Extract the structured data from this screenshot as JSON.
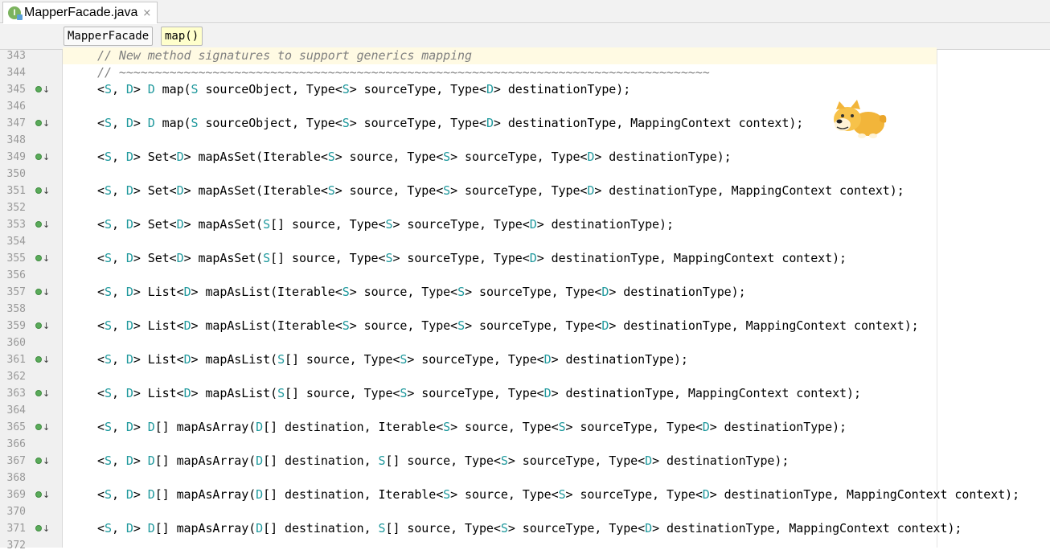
{
  "tab": {
    "title": "MapperFacade.java",
    "icon_letter": "I",
    "close_glyph": "×"
  },
  "breadcrumb": {
    "items": [
      "MapperFacade",
      "map()"
    ]
  },
  "lines": [
    {
      "num": "343",
      "kind": "comment",
      "text": "// New method signatures to support generics mapping",
      "icon": false,
      "highlight": true
    },
    {
      "num": "344",
      "kind": "comment",
      "text": "// ~~~~~~~~~~~~~~~~~~~~~~~~~~~~~~~~~~~~~~~~~~~~~~~~~~~~~~~~~~~~~~~~~~~~~~~~~~~~~~~~~~",
      "icon": false
    },
    {
      "num": "345",
      "kind": "code",
      "icon": true,
      "segs": [
        [
          "<",
          ""
        ],
        [
          "S",
          "tp"
        ],
        [
          ", ",
          ""
        ],
        [
          "D",
          "tp"
        ],
        [
          "> ",
          ""
        ],
        [
          "D",
          "tp"
        ],
        [
          " map(",
          ""
        ],
        [
          "S",
          "tp"
        ],
        [
          " sourceObject, Type<",
          ""
        ],
        [
          "S",
          "tp"
        ],
        [
          "> sourceType, Type<",
          ""
        ],
        [
          "D",
          "tp"
        ],
        [
          "> destinationType);",
          ""
        ]
      ]
    },
    {
      "num": "346",
      "kind": "blank",
      "icon": false
    },
    {
      "num": "347",
      "kind": "code",
      "icon": true,
      "segs": [
        [
          "<",
          ""
        ],
        [
          "S",
          "tp"
        ],
        [
          ", ",
          ""
        ],
        [
          "D",
          "tp"
        ],
        [
          "> ",
          ""
        ],
        [
          "D",
          "tp"
        ],
        [
          " map(",
          ""
        ],
        [
          "S",
          "tp"
        ],
        [
          " sourceObject, Type<",
          ""
        ],
        [
          "S",
          "tp"
        ],
        [
          "> sourceType, Type<",
          ""
        ],
        [
          "D",
          "tp"
        ],
        [
          "> destinationType, MappingContext context);",
          ""
        ]
      ]
    },
    {
      "num": "348",
      "kind": "blank",
      "icon": false
    },
    {
      "num": "349",
      "kind": "code",
      "icon": true,
      "segs": [
        [
          "<",
          ""
        ],
        [
          "S",
          "tp"
        ],
        [
          ", ",
          ""
        ],
        [
          "D",
          "tp"
        ],
        [
          "> Set<",
          ""
        ],
        [
          "D",
          "tp"
        ],
        [
          "> mapAsSet(Iterable<",
          ""
        ],
        [
          "S",
          "tp"
        ],
        [
          "> source, Type<",
          ""
        ],
        [
          "S",
          "tp"
        ],
        [
          "> sourceType, Type<",
          ""
        ],
        [
          "D",
          "tp"
        ],
        [
          "> destinationType);",
          ""
        ]
      ]
    },
    {
      "num": "350",
      "kind": "blank",
      "icon": false
    },
    {
      "num": "351",
      "kind": "code",
      "icon": true,
      "segs": [
        [
          "<",
          ""
        ],
        [
          "S",
          "tp"
        ],
        [
          ", ",
          ""
        ],
        [
          "D",
          "tp"
        ],
        [
          "> Set<",
          ""
        ],
        [
          "D",
          "tp"
        ],
        [
          "> mapAsSet(Iterable<",
          ""
        ],
        [
          "S",
          "tp"
        ],
        [
          "> source, Type<",
          ""
        ],
        [
          "S",
          "tp"
        ],
        [
          "> sourceType, Type<",
          ""
        ],
        [
          "D",
          "tp"
        ],
        [
          "> destinationType, MappingContext context);",
          ""
        ]
      ]
    },
    {
      "num": "352",
      "kind": "blank",
      "icon": false
    },
    {
      "num": "353",
      "kind": "code",
      "icon": true,
      "segs": [
        [
          "<",
          ""
        ],
        [
          "S",
          "tp"
        ],
        [
          ", ",
          ""
        ],
        [
          "D",
          "tp"
        ],
        [
          "> Set<",
          ""
        ],
        [
          "D",
          "tp"
        ],
        [
          "> mapAsSet(",
          ""
        ],
        [
          "S",
          "tp"
        ],
        [
          "[] source, Type<",
          ""
        ],
        [
          "S",
          "tp"
        ],
        [
          "> sourceType, Type<",
          ""
        ],
        [
          "D",
          "tp"
        ],
        [
          "> destinationType);",
          ""
        ]
      ]
    },
    {
      "num": "354",
      "kind": "blank",
      "icon": false
    },
    {
      "num": "355",
      "kind": "code",
      "icon": true,
      "segs": [
        [
          "<",
          ""
        ],
        [
          "S",
          "tp"
        ],
        [
          ", ",
          ""
        ],
        [
          "D",
          "tp"
        ],
        [
          "> Set<",
          ""
        ],
        [
          "D",
          "tp"
        ],
        [
          "> mapAsSet(",
          ""
        ],
        [
          "S",
          "tp"
        ],
        [
          "[] source, Type<",
          ""
        ],
        [
          "S",
          "tp"
        ],
        [
          "> sourceType, Type<",
          ""
        ],
        [
          "D",
          "tp"
        ],
        [
          "> destinationType, MappingContext context);",
          ""
        ]
      ]
    },
    {
      "num": "356",
      "kind": "blank",
      "icon": false
    },
    {
      "num": "357",
      "kind": "code",
      "icon": true,
      "segs": [
        [
          "<",
          ""
        ],
        [
          "S",
          "tp"
        ],
        [
          ", ",
          ""
        ],
        [
          "D",
          "tp"
        ],
        [
          "> List<",
          ""
        ],
        [
          "D",
          "tp"
        ],
        [
          "> mapAsList(Iterable<",
          ""
        ],
        [
          "S",
          "tp"
        ],
        [
          "> source, Type<",
          ""
        ],
        [
          "S",
          "tp"
        ],
        [
          "> sourceType, Type<",
          ""
        ],
        [
          "D",
          "tp"
        ],
        [
          "> destinationType);",
          ""
        ]
      ]
    },
    {
      "num": "358",
      "kind": "blank",
      "icon": false
    },
    {
      "num": "359",
      "kind": "code",
      "icon": true,
      "segs": [
        [
          "<",
          ""
        ],
        [
          "S",
          "tp"
        ],
        [
          ", ",
          ""
        ],
        [
          "D",
          "tp"
        ],
        [
          "> List<",
          ""
        ],
        [
          "D",
          "tp"
        ],
        [
          "> mapAsList(Iterable<",
          ""
        ],
        [
          "S",
          "tp"
        ],
        [
          "> source, Type<",
          ""
        ],
        [
          "S",
          "tp"
        ],
        [
          "> sourceType, Type<",
          ""
        ],
        [
          "D",
          "tp"
        ],
        [
          "> destinationType, MappingContext context);",
          ""
        ]
      ]
    },
    {
      "num": "360",
      "kind": "blank",
      "icon": false
    },
    {
      "num": "361",
      "kind": "code",
      "icon": true,
      "segs": [
        [
          "<",
          ""
        ],
        [
          "S",
          "tp"
        ],
        [
          ", ",
          ""
        ],
        [
          "D",
          "tp"
        ],
        [
          "> List<",
          ""
        ],
        [
          "D",
          "tp"
        ],
        [
          "> mapAsList(",
          ""
        ],
        [
          "S",
          "tp"
        ],
        [
          "[] source, Type<",
          ""
        ],
        [
          "S",
          "tp"
        ],
        [
          "> sourceType, Type<",
          ""
        ],
        [
          "D",
          "tp"
        ],
        [
          "> destinationType);",
          ""
        ]
      ]
    },
    {
      "num": "362",
      "kind": "blank",
      "icon": false
    },
    {
      "num": "363",
      "kind": "code",
      "icon": true,
      "segs": [
        [
          "<",
          ""
        ],
        [
          "S",
          "tp"
        ],
        [
          ", ",
          ""
        ],
        [
          "D",
          "tp"
        ],
        [
          "> List<",
          ""
        ],
        [
          "D",
          "tp"
        ],
        [
          "> mapAsList(",
          ""
        ],
        [
          "S",
          "tp"
        ],
        [
          "[] source, Type<",
          ""
        ],
        [
          "S",
          "tp"
        ],
        [
          "> sourceType, Type<",
          ""
        ],
        [
          "D",
          "tp"
        ],
        [
          "> destinationType, MappingContext context);",
          ""
        ]
      ]
    },
    {
      "num": "364",
      "kind": "blank",
      "icon": false
    },
    {
      "num": "365",
      "kind": "code",
      "icon": true,
      "segs": [
        [
          "<",
          ""
        ],
        [
          "S",
          "tp"
        ],
        [
          ", ",
          ""
        ],
        [
          "D",
          "tp"
        ],
        [
          "> ",
          ""
        ],
        [
          "D",
          "tp"
        ],
        [
          "[] mapAsArray(",
          ""
        ],
        [
          "D",
          "tp"
        ],
        [
          "[] destination, Iterable<",
          ""
        ],
        [
          "S",
          "tp"
        ],
        [
          "> source, Type<",
          ""
        ],
        [
          "S",
          "tp"
        ],
        [
          "> sourceType, Type<",
          ""
        ],
        [
          "D",
          "tp"
        ],
        [
          "> destinationType);",
          ""
        ]
      ]
    },
    {
      "num": "366",
      "kind": "blank",
      "icon": false
    },
    {
      "num": "367",
      "kind": "code",
      "icon": true,
      "segs": [
        [
          "<",
          ""
        ],
        [
          "S",
          "tp"
        ],
        [
          ", ",
          ""
        ],
        [
          "D",
          "tp"
        ],
        [
          "> ",
          ""
        ],
        [
          "D",
          "tp"
        ],
        [
          "[] mapAsArray(",
          ""
        ],
        [
          "D",
          "tp"
        ],
        [
          "[] destination, ",
          ""
        ],
        [
          "S",
          "tp"
        ],
        [
          "[] source, Type<",
          ""
        ],
        [
          "S",
          "tp"
        ],
        [
          "> sourceType, Type<",
          ""
        ],
        [
          "D",
          "tp"
        ],
        [
          "> destinationType);",
          ""
        ]
      ]
    },
    {
      "num": "368",
      "kind": "blank",
      "icon": false
    },
    {
      "num": "369",
      "kind": "code",
      "icon": true,
      "segs": [
        [
          "<",
          ""
        ],
        [
          "S",
          "tp"
        ],
        [
          ", ",
          ""
        ],
        [
          "D",
          "tp"
        ],
        [
          "> ",
          ""
        ],
        [
          "D",
          "tp"
        ],
        [
          "[] mapAsArray(",
          ""
        ],
        [
          "D",
          "tp"
        ],
        [
          "[] destination, Iterable<",
          ""
        ],
        [
          "S",
          "tp"
        ],
        [
          "> source, Type<",
          ""
        ],
        [
          "S",
          "tp"
        ],
        [
          "> sourceType, Type<",
          ""
        ],
        [
          "D",
          "tp"
        ],
        [
          "> destinationType, MappingContext context);",
          ""
        ]
      ]
    },
    {
      "num": "370",
      "kind": "blank",
      "icon": false
    },
    {
      "num": "371",
      "kind": "code",
      "icon": true,
      "segs": [
        [
          "<",
          ""
        ],
        [
          "S",
          "tp"
        ],
        [
          ", ",
          ""
        ],
        [
          "D",
          "tp"
        ],
        [
          "> ",
          ""
        ],
        [
          "D",
          "tp"
        ],
        [
          "[] mapAsArray(",
          ""
        ],
        [
          "D",
          "tp"
        ],
        [
          "[] destination, ",
          ""
        ],
        [
          "S",
          "tp"
        ],
        [
          "[] source, Type<",
          ""
        ],
        [
          "S",
          "tp"
        ],
        [
          "> sourceType, Type<",
          ""
        ],
        [
          "D",
          "tp"
        ],
        [
          "> destinationType, MappingContext context);",
          ""
        ]
      ]
    },
    {
      "num": "372",
      "kind": "blank",
      "icon": false
    }
  ],
  "colors": {
    "type_param": "#20999d",
    "comment": "#808080",
    "gutter_bg": "#f0f0f0",
    "current_line": "#fffae3",
    "interface_icon": "#7bb35e",
    "impl_marker": "#5aab5a"
  }
}
